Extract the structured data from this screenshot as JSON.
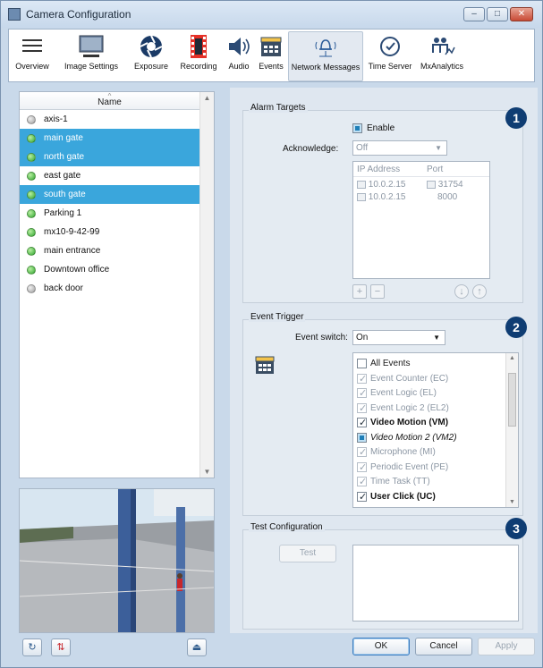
{
  "window": {
    "title": "Camera Configuration"
  },
  "toolbar": {
    "items": [
      {
        "label": "Overview",
        "icon": "list-lines-icon"
      },
      {
        "label": "Image Settings",
        "icon": "monitor-icon"
      },
      {
        "label": "Exposure",
        "icon": "aperture-icon"
      },
      {
        "label": "Recording",
        "icon": "film-strip-icon"
      },
      {
        "label": "Audio",
        "icon": "speaker-icon"
      },
      {
        "label": "Events",
        "icon": "clapperboard-icon"
      },
      {
        "label": "Network Messages",
        "icon": "network-bell-icon"
      },
      {
        "label": "Time Server",
        "icon": "clock-icon"
      },
      {
        "label": "MxAnalytics",
        "icon": "analytics-people-icon"
      }
    ],
    "active": "Network Messages"
  },
  "camera_list": {
    "header": "Name",
    "items": [
      {
        "name": "axis-1",
        "status": "gray",
        "selected": false
      },
      {
        "name": "main gate",
        "status": "green",
        "selected": true
      },
      {
        "name": "north gate",
        "status": "green",
        "selected": true
      },
      {
        "name": "east gate",
        "status": "green",
        "selected": false
      },
      {
        "name": "south gate",
        "status": "green",
        "selected": true
      },
      {
        "name": "Parking 1",
        "status": "green",
        "selected": false
      },
      {
        "name": "mx10-9-42-99",
        "status": "green",
        "selected": false
      },
      {
        "name": "main entrance",
        "status": "green",
        "selected": false
      },
      {
        "name": "Downtown office",
        "status": "green",
        "selected": false
      },
      {
        "name": "back door",
        "status": "gray",
        "selected": false
      }
    ]
  },
  "alarm_targets": {
    "title": "Alarm Targets",
    "badge": "1",
    "enable_label": "Enable",
    "enable_checked": true,
    "acknowledge_label": "Acknowledge:",
    "acknowledge_value": "Off",
    "table_headers": [
      "IP Address",
      "Port"
    ],
    "table_rows": [
      {
        "ip": "10.0.2.15",
        "port": "31754"
      },
      {
        "ip": "10.0.2.15",
        "port": "8000"
      }
    ]
  },
  "event_trigger": {
    "title": "Event Trigger",
    "badge": "2",
    "switch_label": "Event switch:",
    "switch_value": "On",
    "events": [
      {
        "label": "All Events",
        "state": "unchecked",
        "style": "normal"
      },
      {
        "label": "Event Counter (EC)",
        "state": "checked-dim",
        "style": "dim"
      },
      {
        "label": "Event Logic (EL)",
        "state": "checked-dim",
        "style": "dim"
      },
      {
        "label": "Event Logic 2 (EL2)",
        "state": "checked-dim",
        "style": "dim"
      },
      {
        "label": "Video Motion (VM)",
        "state": "checked",
        "style": "bold"
      },
      {
        "label": "Video Motion 2 (VM2)",
        "state": "filled",
        "style": "italic"
      },
      {
        "label": "Microphone (MI)",
        "state": "checked-dim",
        "style": "dim"
      },
      {
        "label": "Periodic Event (PE)",
        "state": "checked-dim",
        "style": "dim"
      },
      {
        "label": "Time Task (TT)",
        "state": "checked-dim",
        "style": "dim"
      },
      {
        "label": "User Click (UC)",
        "state": "checked",
        "style": "bold"
      }
    ]
  },
  "test_configuration": {
    "title": "Test Configuration",
    "badge": "3",
    "test_button": "Test"
  },
  "footer": {
    "ok": "OK",
    "cancel": "Cancel",
    "apply": "Apply"
  },
  "colors": {
    "selection": "#3aa6dc",
    "badge": "#0f3d73",
    "status_green": "#2ea42c",
    "status_gray": "#9c9c9c"
  }
}
